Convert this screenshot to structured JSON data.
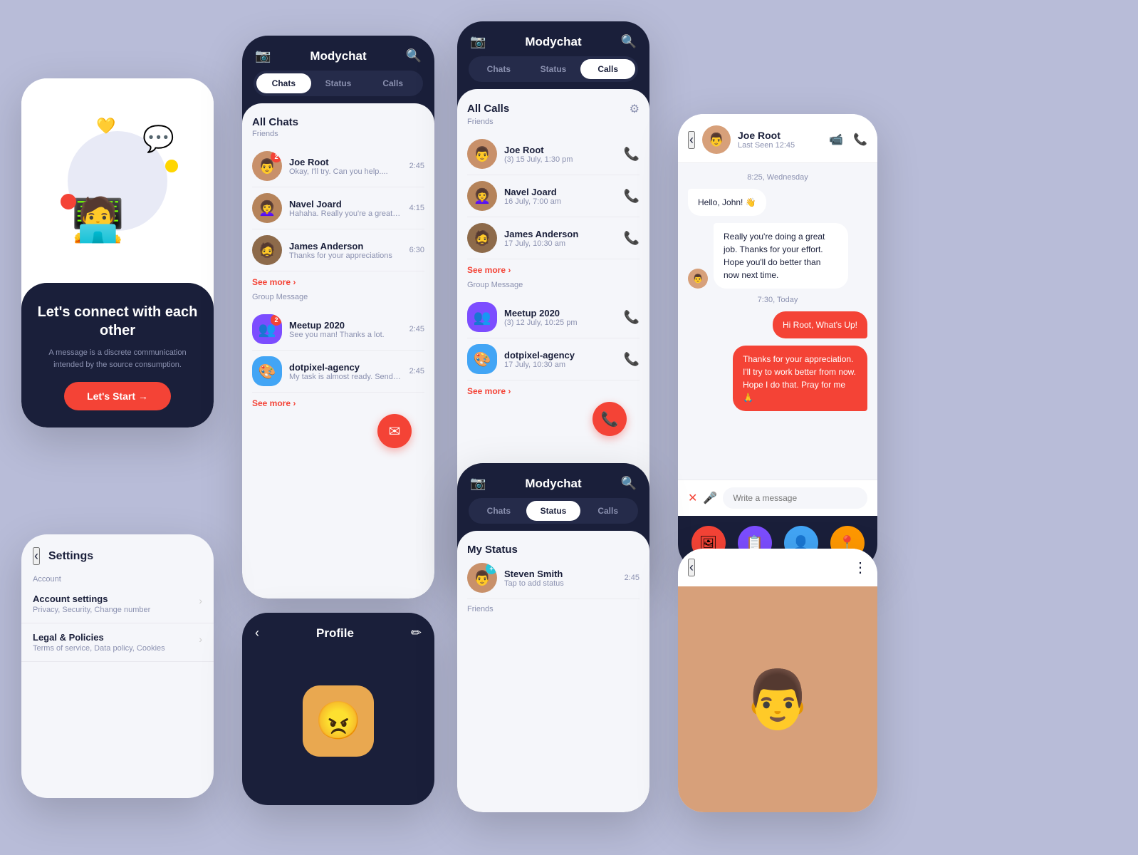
{
  "app": {
    "name": "Modychat",
    "camera_icon": "📷",
    "search_icon": "🔍",
    "filter_icon": "⚙",
    "back_icon": "‹",
    "edit_icon": "✏"
  },
  "tabs": {
    "chats": "Chats",
    "status": "Status",
    "calls": "Calls"
  },
  "welcome": {
    "title": "Let's connect\nwith each other",
    "subtitle": "A message is a discrete communication\nintended by the source consumption.",
    "button": "Let's Start →"
  },
  "all_chats": {
    "title": "All Chats",
    "friends_label": "Friends",
    "group_label": "Group Message",
    "see_more": "See more ›",
    "friends": [
      {
        "name": "Joe Root",
        "preview": "Okay, I'll try. Can you help....",
        "time": "2:45",
        "badge": "2",
        "emoji": "👨"
      },
      {
        "name": "Navel Joard",
        "preview": "Hahaha. Really you're a great person",
        "time": "4:15",
        "badge": "",
        "emoji": "👩‍🦱"
      },
      {
        "name": "James Anderson",
        "preview": "Thanks for your appreciations",
        "time": "6:30",
        "badge": "",
        "emoji": "🧔"
      }
    ],
    "groups": [
      {
        "name": "Meetup 2020",
        "preview": "See you man! Thanks a lot.",
        "time": "2:45",
        "badge": "2",
        "emoji": "👥"
      },
      {
        "name": "dotpixel-agency",
        "preview": "My task is almost ready. Send it..",
        "time": "2:45",
        "badge": "",
        "emoji": "🎨"
      }
    ]
  },
  "all_calls": {
    "title": "All Calls",
    "friends_label": "Friends",
    "group_label": "Group Message",
    "see_more": "See more ›",
    "friends": [
      {
        "name": "Joe Root",
        "detail": "(3) 15 July, 1:30 pm",
        "emoji": "👨"
      },
      {
        "name": "Navel Joard",
        "detail": "16 July, 7:00 am",
        "emoji": "👩‍🦱"
      },
      {
        "name": "James Anderson",
        "detail": "17 July, 10:30 am",
        "emoji": "🧔"
      }
    ],
    "groups": [
      {
        "name": "Meetup 2020",
        "detail": "(3) 12 July, 10:25 pm",
        "emoji": "👥",
        "type": "purple"
      },
      {
        "name": "dotpixel-agency",
        "detail": "17 July, 10:30 am",
        "emoji": "🎨",
        "type": "blue"
      }
    ]
  },
  "chat_detail": {
    "contact_name": "Joe Root",
    "contact_status": "Last Seen 12:45",
    "msg_time1": "8:25, Wednesday",
    "msg_time2": "7:30, Today",
    "messages": [
      {
        "text": "Hello, John! 👋",
        "type": "incoming",
        "has_avatar": false
      },
      {
        "text": "Really you're doing a great job. Thanks for your effort. Hope you'll do better than now next time.",
        "type": "incoming",
        "has_avatar": true
      },
      {
        "text": "Hi Root, What's Up!",
        "type": "outgoing"
      },
      {
        "text": "Thanks for your appreciation. I'll try to work better from now. Hope I do that. Pray for me 🙏",
        "type": "outgoing"
      }
    ],
    "input_placeholder": "Write a message",
    "bottom_actions": [
      "🖼",
      "📋",
      "👤",
      "📍"
    ]
  },
  "settings": {
    "title": "Settings",
    "section_account": "Account",
    "items": [
      {
        "title": "Account settings",
        "sub": "Privacy, Security, Change number"
      },
      {
        "title": "Legal & Policies",
        "sub": "Terms of service, Data policy, Cookies"
      }
    ]
  },
  "profile": {
    "title": "Profile",
    "emoji": "😠"
  },
  "my_status": {
    "title": "My Status",
    "contact_name": "Steven Smith",
    "contact_time": "2:45",
    "contact_sub": "Tap to add status",
    "friends_label": "Friends"
  }
}
